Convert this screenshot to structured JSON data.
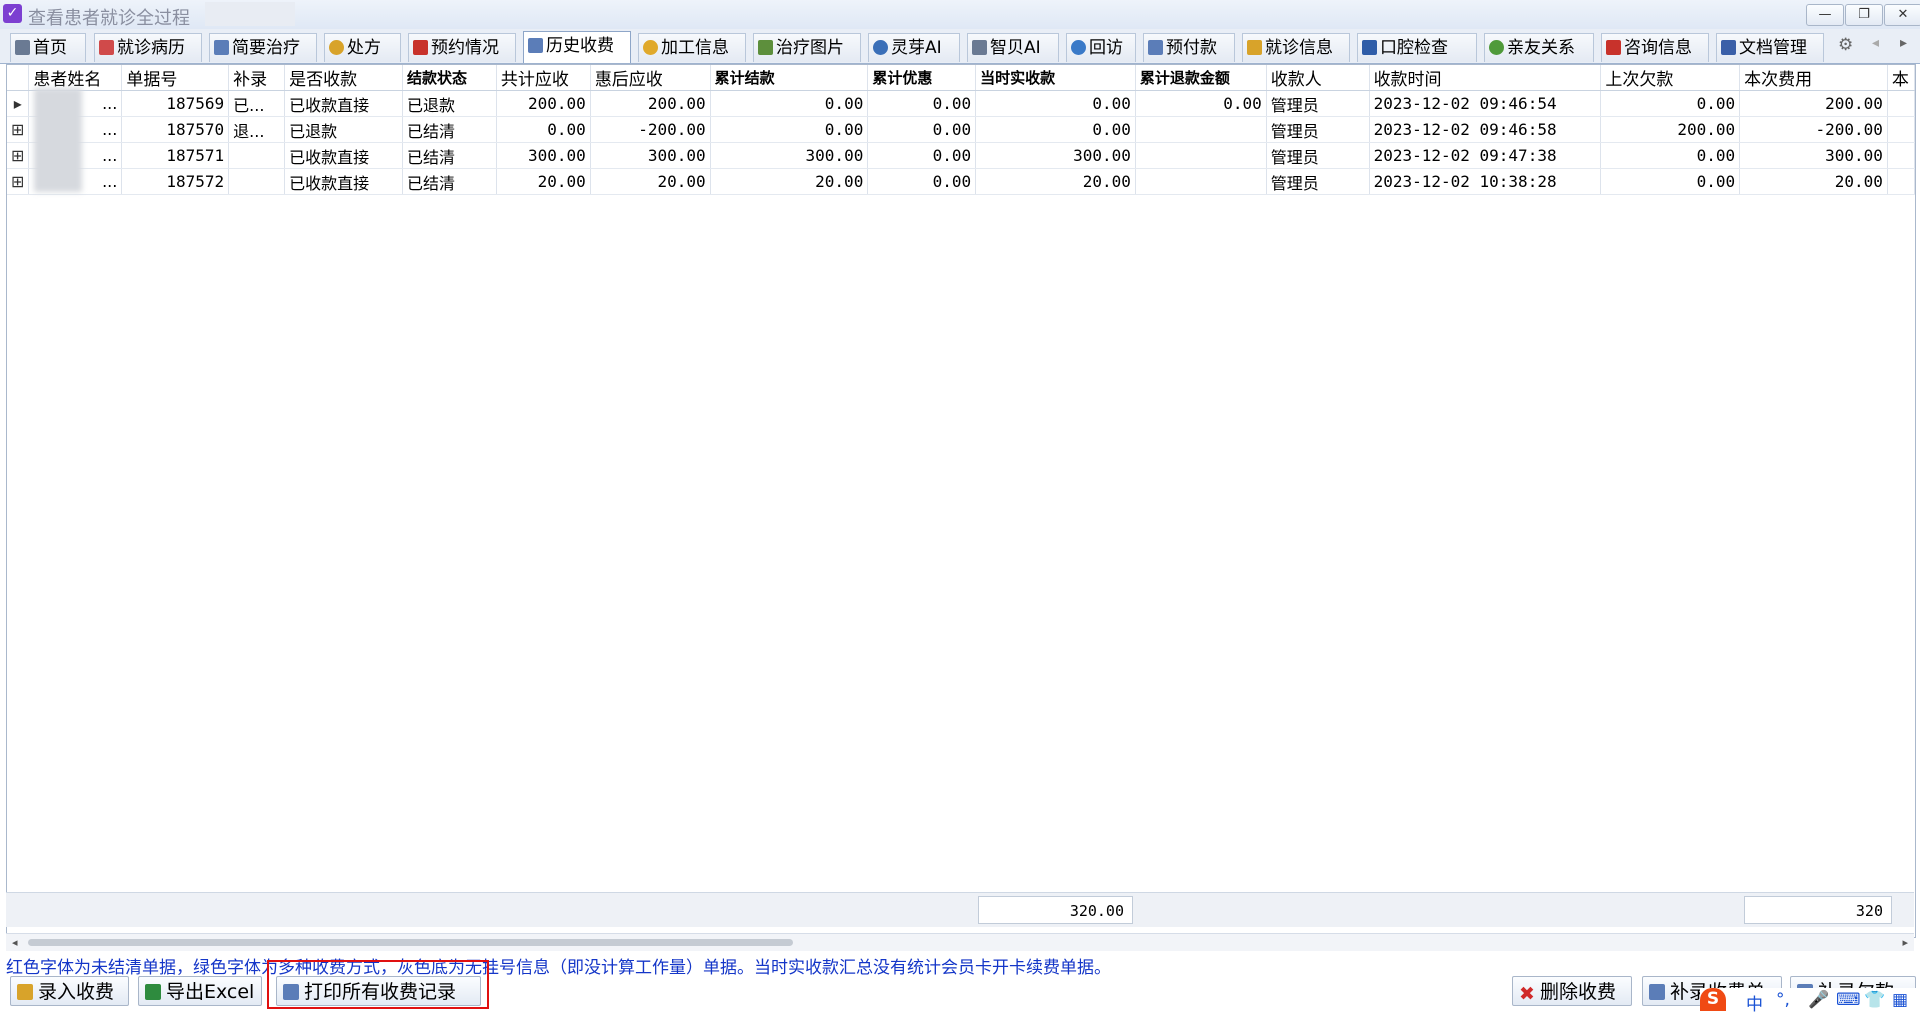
{
  "window": {
    "title": "查看患者就诊全过程",
    "controls": [
      "—",
      "❐",
      "✕"
    ]
  },
  "tabs": [
    {
      "label": "首页",
      "icon": "home-icon",
      "color": "#6a7a93"
    },
    {
      "label": "就诊病历",
      "icon": "medical-record-icon",
      "color": "#d04a4a"
    },
    {
      "label": "简要治疗",
      "icon": "document-icon",
      "color": "#5b7db8"
    },
    {
      "label": "处方",
      "icon": "pill-icon",
      "color": "#d8a32a"
    },
    {
      "label": "预约情况",
      "icon": "calendar-icon",
      "color": "#c8322b"
    },
    {
      "label": "历史收费",
      "icon": "billing-history-icon",
      "color": "#5b7db8"
    },
    {
      "label": "加工信息",
      "icon": "processing-icon",
      "color": "#e0a92b"
    },
    {
      "label": "治疗图片",
      "icon": "image-icon",
      "color": "#5d8f3c"
    },
    {
      "label": "灵芽AI",
      "icon": "eye-icon",
      "color": "#3a6fb8"
    },
    {
      "label": "智贝AI",
      "icon": "tooth-ai-icon",
      "color": "#6a7a93"
    },
    {
      "label": "回访",
      "icon": "refresh-icon",
      "color": "#3a7ac8"
    },
    {
      "label": "预付款",
      "icon": "prepay-icon",
      "color": "#5b7db8"
    },
    {
      "label": "就诊信息",
      "icon": "info-icon",
      "color": "#d8a32a"
    },
    {
      "label": "口腔检查",
      "icon": "briefcase-icon",
      "color": "#2f5da8"
    },
    {
      "label": "亲友关系",
      "icon": "people-icon",
      "color": "#4f9a3a"
    },
    {
      "label": "咨询信息",
      "icon": "consult-icon",
      "color": "#c8322b"
    },
    {
      "label": "文档管理",
      "icon": "spellcheck-icon",
      "color": "#3a5fa8"
    }
  ],
  "active_tab": "历史收费",
  "grid": {
    "columns": [
      "患者姓名",
      "单据号",
      "补录",
      "是否收款",
      "结款状态",
      "共计应收",
      "惠后应收",
      "累计结款",
      "累计优惠",
      "当时实收款",
      "累计退款金额",
      "收款人",
      "收款时间",
      "上次欠款",
      "本次费用",
      "本"
    ],
    "rows": [
      {
        "indicator": "▸",
        "name": "...",
        "bill_no": "187569",
        "supplement": "已...",
        "paid": "已收款直接",
        "settle": "已退款",
        "total": "200.00",
        "discounted": "200.00",
        "settled_sum": "0.00",
        "discount_sum": "0.00",
        "received": "0.00",
        "refund": "0.00",
        "cashier": "管理员",
        "time": "2023-12-02 09:46:54",
        "prev_debt": "0.00",
        "fee": "200.00"
      },
      {
        "indicator": "⊞",
        "name": "...",
        "bill_no": "187570",
        "supplement": "退...",
        "paid": "已退款",
        "settle": "已结清",
        "total": "0.00",
        "discounted": "-200.00",
        "settled_sum": "0.00",
        "discount_sum": "0.00",
        "received": "0.00",
        "refund": "",
        "cashier": "管理员",
        "time": "2023-12-02 09:46:58",
        "prev_debt": "200.00",
        "fee": "-200.00"
      },
      {
        "indicator": "⊞",
        "name": "...",
        "bill_no": "187571",
        "supplement": "",
        "paid": "已收款直接",
        "settle": "已结清",
        "total": "300.00",
        "discounted": "300.00",
        "settled_sum": "300.00",
        "discount_sum": "0.00",
        "received": "300.00",
        "refund": "",
        "cashier": "管理员",
        "time": "2023-12-02 09:47:38",
        "prev_debt": "0.00",
        "fee": "300.00"
      },
      {
        "indicator": "⊞",
        "name": "...",
        "bill_no": "187572",
        "supplement": "",
        "paid": "已收款直接",
        "settle": "已结清",
        "total": "20.00",
        "discounted": "20.00",
        "settled_sum": "20.00",
        "discount_sum": "0.00",
        "received": "20.00",
        "refund": "",
        "cashier": "管理员",
        "time": "2023-12-02 10:38:28",
        "prev_debt": "0.00",
        "fee": "20.00"
      }
    ],
    "footer": {
      "received_total": "320.00",
      "fee_total": "320"
    }
  },
  "note": "红色字体为未结清单据，绿色字体为多种收费方式，灰色底为无挂号信息（即没计算工作量）单据。当时实收款汇总没有统计会员卡开卡续费单据。",
  "buttons": {
    "add_charge": "录入收费",
    "export_excel": "导出Excel",
    "print_all": "打印所有收费记录",
    "delete_charge": "删除收费",
    "supplement": "补录收费单",
    "supplement2": "补录欠款"
  },
  "ime": {
    "lang": "中",
    "punct": "°,"
  }
}
